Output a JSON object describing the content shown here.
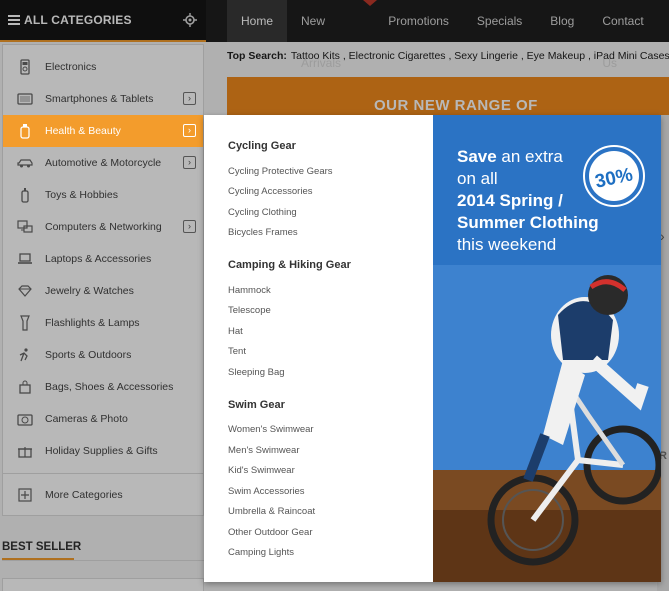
{
  "header": {
    "all_categories": "ALL CATEGORIES",
    "nav": [
      "Home",
      "New Arrivals",
      "Promotions",
      "Specials",
      "Blog",
      "Contact Us"
    ]
  },
  "top_search": {
    "label": "Top Search:",
    "terms": "Tattoo Kits , Electronic Cigarettes , Sexy Lingerie , Eye Makeup , iPad Mini Cases , Hom"
  },
  "promo_text": "OUR NEW RANGE OF",
  "sidebar": {
    "items": [
      {
        "label": "Electronics",
        "icon": "ipod-icon",
        "arrow": false
      },
      {
        "label": "Smartphones & Tablets",
        "icon": "tablet-icon",
        "arrow": true
      },
      {
        "label": "Health & Beauty",
        "icon": "bottle-icon",
        "arrow": true,
        "active": true
      },
      {
        "label": "Automotive & Motorcycle",
        "icon": "car-icon",
        "arrow": true
      },
      {
        "label": "Toys & Hobbies",
        "icon": "baby-bottle-icon",
        "arrow": false
      },
      {
        "label": "Computers & Networking",
        "icon": "network-icon",
        "arrow": true
      },
      {
        "label": "Laptops & Accessories",
        "icon": "laptop-icon",
        "arrow": false
      },
      {
        "label": "Jewelry & Watches",
        "icon": "diamond-icon",
        "arrow": false
      },
      {
        "label": "Flashlights & Lamps",
        "icon": "flashlight-icon",
        "arrow": false
      },
      {
        "label": "Sports & Outdoors",
        "icon": "sports-icon",
        "arrow": false
      },
      {
        "label": "Bags, Shoes & Accessories",
        "icon": "bag-icon",
        "arrow": false
      },
      {
        "label": "Cameras & Photo",
        "icon": "camera-icon",
        "arrow": false
      },
      {
        "label": "Holiday Supplies & Gifts",
        "icon": "gift-icon",
        "arrow": false
      }
    ],
    "more": "More Categories"
  },
  "best_seller": "BEST SELLER",
  "mega_menu": {
    "groups": [
      {
        "title": "Cycling Gear",
        "links": [
          "Cycling Protective Gears",
          "Cycling Accessories",
          "Cycling Clothing",
          "Bicycles Frames"
        ]
      },
      {
        "title": "Camping & Hiking Gear",
        "links": [
          "Hammock",
          "Telescope",
          "Hat",
          "Tent",
          "Sleeping Bag"
        ]
      },
      {
        "title": "Swim Gear",
        "links": [
          "Women's Swimwear",
          "Men's Swimwear",
          "Kid's Swimwear",
          "Swim Accessories",
          "Umbrella & Raincoat",
          "Other Outdoor Gear",
          "Camping Lights"
        ]
      }
    ],
    "banner": {
      "line1_bold": "Save",
      "line1_rest": " an extra",
      "line2": "on all",
      "line3": "2014 Spring /",
      "line4": "Summer Clothing",
      "line5": "this weekend",
      "badge": "30%"
    }
  },
  "colors": {
    "accent": "#f39c2c",
    "banner_blue": "#2b73c4",
    "nav_bg": "#1f1f1f"
  }
}
